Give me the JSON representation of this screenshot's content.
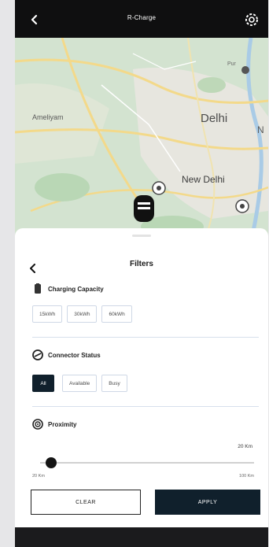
{
  "header": {
    "title": "R-Charge",
    "back_icon": "chevron-left-icon",
    "settings_icon": "gear-icon"
  },
  "map": {
    "labels": {
      "city_big": "Delhi",
      "city_mid": "New Delhi",
      "left_town": "Ameliyam",
      "top_right": "Pur",
      "edge": "N"
    }
  },
  "filters": {
    "title": "Filters",
    "charging_capacity": {
      "title": "Charging Capacity",
      "options": [
        "15kWh",
        "30kWh",
        "60kWh"
      ]
    },
    "connector_status": {
      "title": "Connector Status",
      "options": [
        "All",
        "Available",
        "Busy"
      ],
      "selected": "All"
    },
    "proximity": {
      "title": "Proximity",
      "value": "20 Km",
      "min_label": "20 Km",
      "max_label": "100 Km",
      "position": 0.05
    },
    "clear_label": "CLEAR",
    "apply_label": "APPLY"
  },
  "colors": {
    "dark": "#10202c",
    "map_green": "#cfe0cf",
    "road_yellow": "#f3d98a"
  }
}
